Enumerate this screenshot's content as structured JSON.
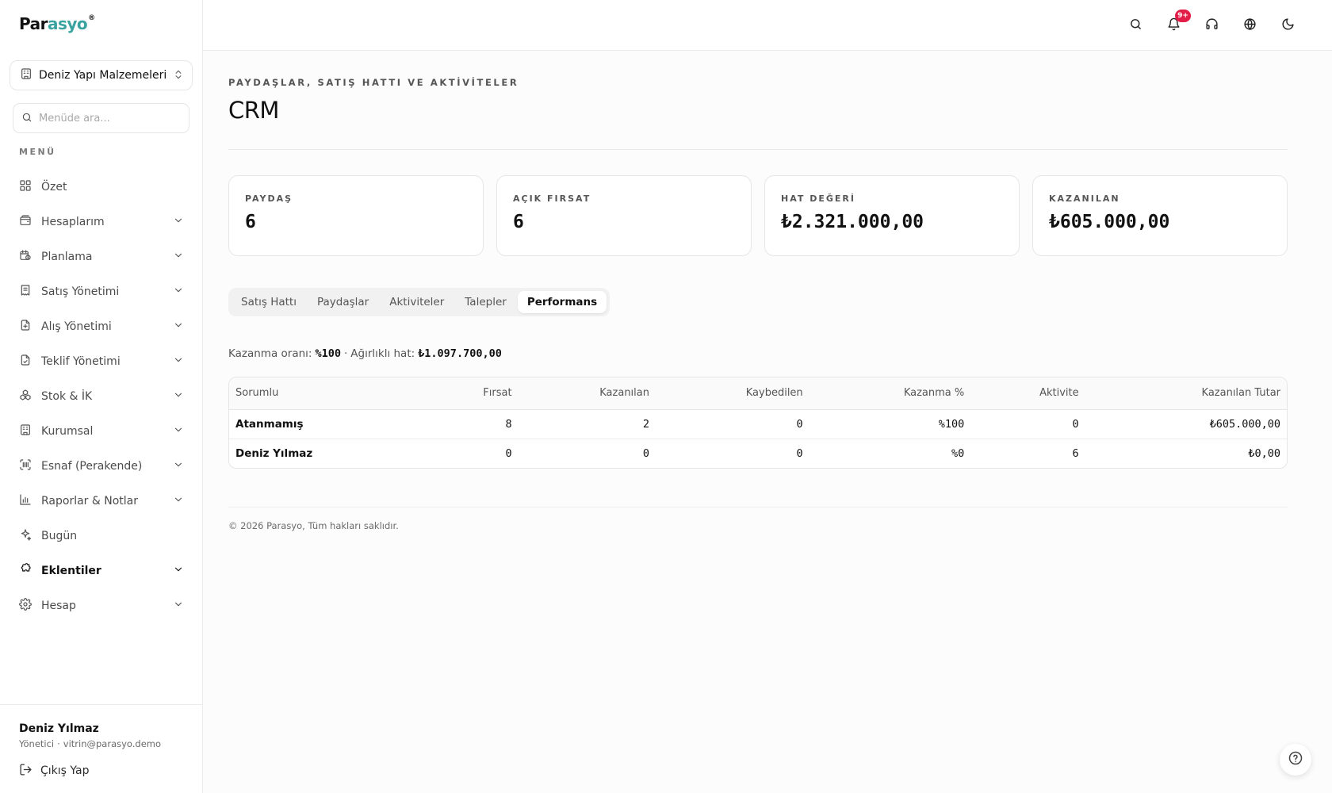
{
  "app": {
    "logo_main": "Par",
    "logo_accent": "asyo",
    "logo_mark": "®"
  },
  "sidebar": {
    "company": "Deniz Yapı Malzemeleri...",
    "search_placeholder": "Menüde ara...",
    "menu_title": "MENÜ",
    "items": [
      {
        "label": "Özet",
        "icon": "grid-icon",
        "has_chevron": false
      },
      {
        "label": "Hesaplarım",
        "icon": "wallet-icon",
        "has_chevron": true
      },
      {
        "label": "Planlama",
        "icon": "calendar-clock-icon",
        "has_chevron": true
      },
      {
        "label": "Satış Yönetimi",
        "icon": "receipt-icon",
        "has_chevron": true
      },
      {
        "label": "Alış Yönetimi",
        "icon": "file-plus-icon",
        "has_chevron": true
      },
      {
        "label": "Teklif Yönetimi",
        "icon": "file-check-icon",
        "has_chevron": true
      },
      {
        "label": "Stok & İK",
        "icon": "boxes-icon",
        "has_chevron": true
      },
      {
        "label": "Kurumsal",
        "icon": "building-icon",
        "has_chevron": true
      },
      {
        "label": "Esnaf (Perakende)",
        "icon": "barcode-icon",
        "has_chevron": true
      },
      {
        "label": "Raporlar & Notlar",
        "icon": "bar-chart-icon",
        "has_chevron": true
      },
      {
        "label": "Bugün",
        "icon": "sparkles-icon",
        "has_chevron": false
      },
      {
        "label": "Eklentiler",
        "icon": "puzzle-icon",
        "has_chevron": true,
        "active": true
      },
      {
        "label": "Hesap",
        "icon": "settings-icon",
        "has_chevron": true
      }
    ],
    "user": {
      "name": "Deniz Yılmaz",
      "role": "Yönetici",
      "separator": "·",
      "email": "vitrin@parasyo.demo",
      "logout_label": "Çıkış Yap"
    }
  },
  "topbar": {
    "notification_badge": "9+"
  },
  "main": {
    "eyebrow": "PAYDAŞLAR, SATIŞ HATTI VE AKTİVİTELER",
    "title": "CRM",
    "stats": [
      {
        "label": "PAYDAŞ",
        "value": "6"
      },
      {
        "label": "AÇIK FIRSAT",
        "value": "6"
      },
      {
        "label": "HAT DEĞERİ",
        "value": "₺2.321.000,00"
      },
      {
        "label": "KAZANILAN",
        "value": "₺605.000,00"
      }
    ],
    "tabs": [
      {
        "label": "Satış Hattı"
      },
      {
        "label": "Paydaşlar"
      },
      {
        "label": "Aktiviteler"
      },
      {
        "label": "Talepler"
      },
      {
        "label": "Performans",
        "active": true
      }
    ],
    "summary": {
      "win_rate_label": "Kazanma oranı:",
      "win_rate_value": "%100",
      "separator": "·",
      "weighted_label": "Ağırlıklı hat:",
      "weighted_value": "₺1.097.700,00"
    },
    "table": {
      "headers": [
        "Sorumlu",
        "Fırsat",
        "Kazanılan",
        "Kaybedilen",
        "Kazanma %",
        "Aktivite",
        "Kazanılan Tutar"
      ],
      "rows": [
        [
          "Atanmamış",
          "8",
          "2",
          "0",
          "%100",
          "0",
          "₺605.000,00"
        ],
        [
          "Deniz Yılmaz",
          "0",
          "0",
          "0",
          "%0",
          "6",
          "₺0,00"
        ]
      ]
    },
    "copyright": "© 2026 Parasyo, Tüm hakları saklıdır."
  },
  "colors": {
    "brand_accent": "#3aa3a0",
    "badge": "#e11d48"
  }
}
